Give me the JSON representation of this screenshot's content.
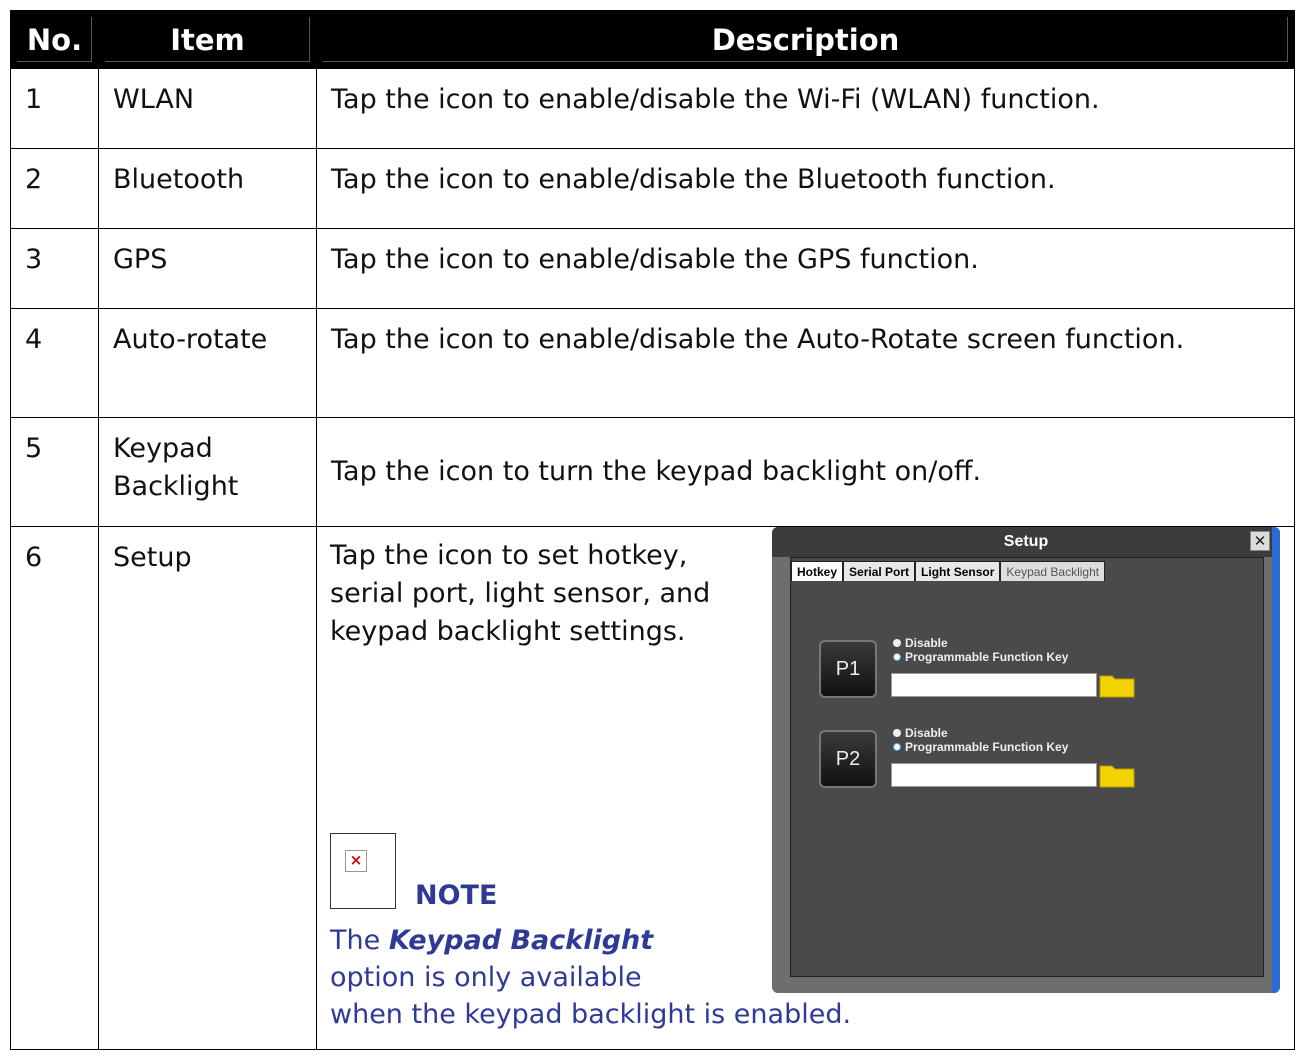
{
  "table": {
    "headers": [
      "No.",
      "Item",
      "Description"
    ],
    "rows": [
      {
        "no": "1",
        "item": "WLAN",
        "desc": "Tap the icon to enable/disable the Wi-Fi (WLAN) function."
      },
      {
        "no": "2",
        "item": "Bluetooth",
        "desc": "Tap the icon to enable/disable the Bluetooth function."
      },
      {
        "no": "3",
        "item": "GPS",
        "desc": "Tap the icon to enable/disable the GPS function."
      },
      {
        "no": "4",
        "item": "Auto-rotate",
        "desc": "Tap the icon to enable/disable the Auto-Rotate screen function."
      },
      {
        "no": "5",
        "item_line1": "Keypad",
        "item_line2": "Backlight",
        "desc": "Tap the icon to turn the keypad backlight on/off."
      },
      {
        "no": "6",
        "item": "Setup",
        "desc": "Tap the icon to set hotkey, serial port, light sensor, and keypad backlight settings."
      }
    ]
  },
  "note": {
    "title": "NOTE",
    "text_before": "The ",
    "emphasis": "Keypad Backlight",
    "text_after1": "option is only available",
    "text_after2": "when the keypad backlight is enabled.",
    "color": "#2f3a96",
    "icon": "broken-image-icon"
  },
  "setup_window": {
    "title": "Setup",
    "close_label": "✕",
    "tabs": [
      "Hotkey",
      "Serial Port",
      "Light Sensor",
      "Keypad Backlight"
    ],
    "keys": [
      {
        "label": "P1",
        "option_disable": "Disable",
        "option_pfk": "Programmable Function Key",
        "value": ""
      },
      {
        "label": "P2",
        "option_disable": "Disable",
        "option_pfk": "Programmable Function Key",
        "value": ""
      }
    ]
  }
}
